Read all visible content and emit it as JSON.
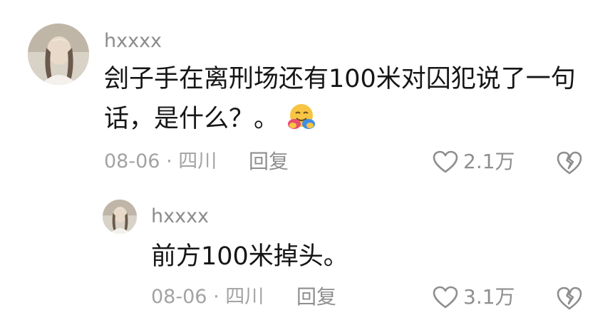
{
  "comments": [
    {
      "username": "hxxxx",
      "text": "刽子手在离刑场还有100米对囚犯说了一句话，是什么？。",
      "emoji": "hugging-face-emoji",
      "date": "08-06",
      "location": "四川",
      "reply_label": "回复",
      "likes": "2.1万",
      "replies": [
        {
          "username": "hxxxx",
          "text": "前方100米掉头。",
          "date": "08-06",
          "location": "四川",
          "reply_label": "回复",
          "likes": "3.1万"
        }
      ]
    }
  ],
  "separator": "·",
  "colors": {
    "text": "#161616",
    "meta": "#a3a3a3",
    "username": "#8c8c8c",
    "background": "#ffffff"
  }
}
